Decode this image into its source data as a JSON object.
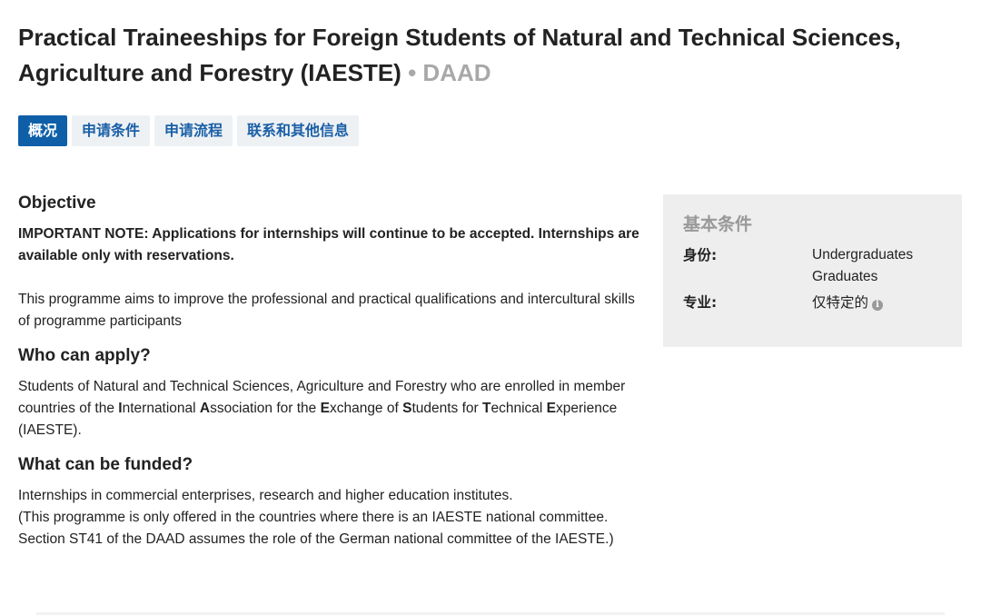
{
  "header": {
    "title": "Practical Traineeships for Foreign Students of Natural and Technical Sciences, Agriculture and Forestry (IAESTE)",
    "separator": "•",
    "org": "DAAD"
  },
  "tabs": [
    {
      "label": "概况",
      "active": true
    },
    {
      "label": "申请条件",
      "active": false
    },
    {
      "label": "申请流程",
      "active": false
    },
    {
      "label": "联系和其他信息",
      "active": false
    }
  ],
  "content": {
    "objective_heading": "Objective",
    "important_note": "IMPORTANT NOTE: Applications for internships will continue to be accepted. Internships are available only with reservations.",
    "objective_text": "This programme aims to improve the professional and practical qualifications and intercultural skills of programme participants",
    "who_heading": "Who can apply?",
    "who_text": {
      "t1": "Students of Natural and Technical Sciences, Agriculture and Forestry who are enrolled in member countries of the ",
      "b1": "I",
      "t2": "nternational ",
      "b2": "A",
      "t3": "ssociation for the ",
      "b3": "E",
      "t4": "xchange of ",
      "b4": "S",
      "t5": "tudents for ",
      "b5": "T",
      "t6": "echnical ",
      "b6": "E",
      "t7": "xperience (IAESTE)."
    },
    "what_heading": "What can be funded?",
    "what_text_1": "Internships in commercial enterprises, research and higher education institutes.",
    "what_text_2": "(This programme is only offered in the countries where there is an IAESTE national committee. Section ST41 of the DAAD assumes the role of the German national committee of the IAESTE.)"
  },
  "sidebar": {
    "heading": "基本条件",
    "status_label": "身份:",
    "status_values": [
      "Undergraduates",
      "Graduates"
    ],
    "field_label": "专业:",
    "field_value": "仅特定的",
    "info_icon": "i"
  },
  "colors": {
    "accent": "#0f5fa8",
    "tab_text": "#1a5fa7",
    "muted": "#a8a8a8",
    "sidebar_bg": "#eeeeee"
  }
}
